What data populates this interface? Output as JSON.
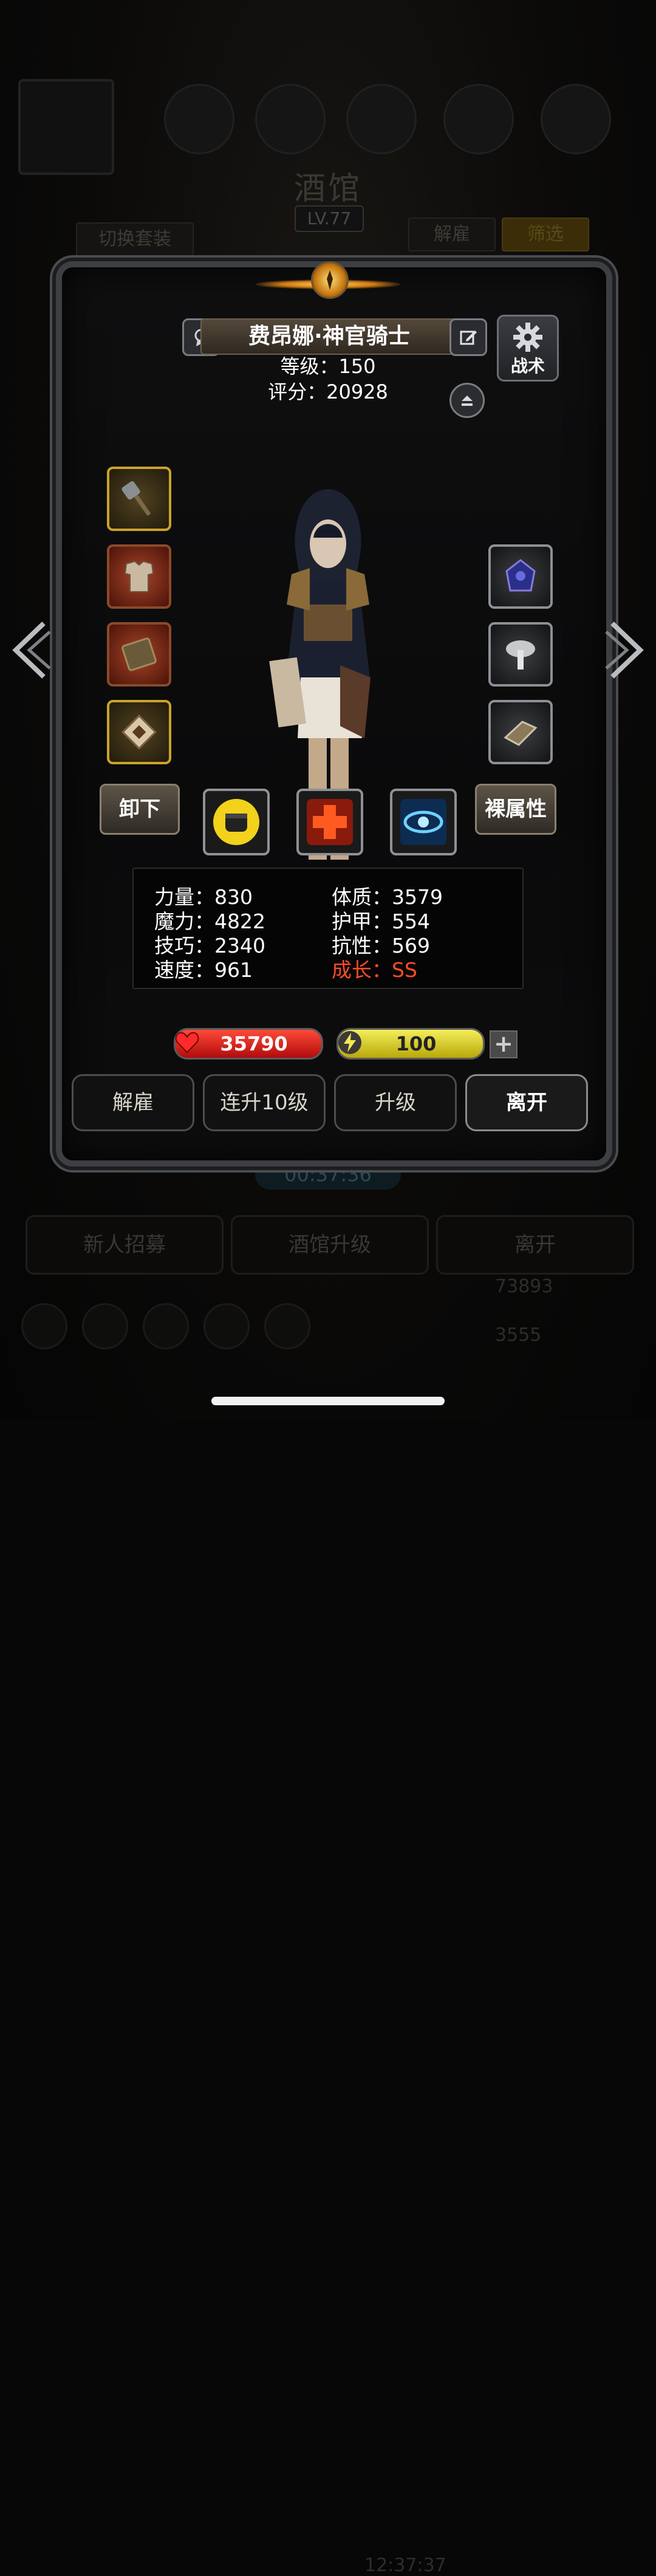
{
  "background": {
    "title": "酒馆",
    "level_badge": "LV.77",
    "switch_outfit": "切换套装",
    "dismiss_tab": "解雇",
    "filter_tab": "筛选",
    "timer": "00:37:36",
    "bottom_buttons": [
      "新人招募",
      "酒馆升级",
      "离开"
    ],
    "clock": "12:37:37",
    "gold": "73893",
    "gems": "3555"
  },
  "hero": {
    "name": "费昂娜·神官骑士",
    "level_label": "等级：150",
    "score_label": "评分：20928",
    "tactics_label": "战术"
  },
  "equipment": {
    "left": [
      {
        "name": "mace",
        "icon": "mace-icon",
        "rarity": "gold"
      },
      {
        "name": "armor",
        "icon": "armor-icon",
        "rarity": "red"
      },
      {
        "name": "book",
        "icon": "book-icon",
        "rarity": "red"
      },
      {
        "name": "rune",
        "icon": "rune-icon",
        "rarity": "gold"
      }
    ],
    "right": [
      {
        "name": "gem",
        "icon": "gem-icon",
        "rarity": "gray"
      },
      {
        "name": "mushroom",
        "icon": "mushroom-icon",
        "rarity": "gray"
      },
      {
        "name": "bracer",
        "icon": "bracer-icon",
        "rarity": "gray"
      }
    ]
  },
  "actions": {
    "unequip": "卸下",
    "base_attributes": "裸属性"
  },
  "skills": [
    {
      "icon": "fist-icon",
      "color": "#f2d21a"
    },
    {
      "icon": "cross-icon",
      "color": "#e8421a"
    },
    {
      "icon": "eye-icon",
      "color": "#2f8fd9"
    }
  ],
  "stats": {
    "strength": "力量：830",
    "magic": "魔力：4822",
    "skill": "技巧：2340",
    "speed": "速度：961",
    "constitution": "体质：3579",
    "armor": "护甲：554",
    "resistance": "抗性：569",
    "growth": "成长：SS"
  },
  "bars": {
    "hp": "35790",
    "energy": "100",
    "plus": "+"
  },
  "panel_buttons": [
    "解雇",
    "连升10级",
    "升级",
    "离开"
  ],
  "colors": {
    "growth_red": "#ff4a2a",
    "hp_red": "#d6181a",
    "energy_yellow": "#e3d62a",
    "gold_border": "#c9a429"
  }
}
